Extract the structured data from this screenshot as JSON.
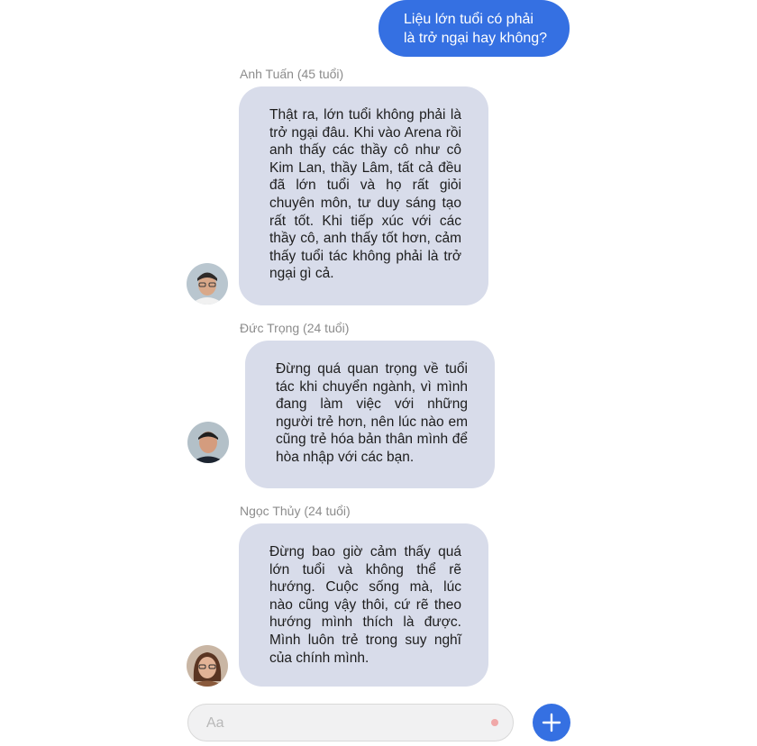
{
  "question": "Liệu lớn tuổi có phải là trở ngại hay không?",
  "messages": [
    {
      "sender": "Anh Tuấn (45 tuổi)",
      "text": "Thật ra, lớn tuổi không phải là trở ngại đâu. Khi vào Arena rồi anh thấy các thầy cô như cô Kim Lan, thầy Lâm, tất cả đều đã lớn tuổi và họ rất giỏi chuyên môn, tư duy sáng tạo rất tốt. Khi tiếp xúc với các thầy cô, anh thấy tốt hơn, cảm thấy tuổi tác không phải là trở ngại gì cả."
    },
    {
      "sender": "Đức Trọng (24 tuổi)",
      "text": "Đừng quá quan trọng về tuổi tác khi chuyển ngành, vì mình đang làm việc với những người trẻ hơn, nên lúc nào em cũng trẻ hóa bản thân mình để hòa nhập với các bạn."
    },
    {
      "sender": "Ngọc Thủy (24 tuổi)",
      "text": "Đừng bao giờ cảm thấy quá lớn tuổi và không thể rẽ hướng. Cuộc sống mà, lúc nào cũng vậy thôi, cứ rẽ theo hướng mình thích là được. Mình luôn trẻ trong suy nghĩ của chính mình."
    }
  ],
  "composer": {
    "placeholder": "Aa",
    "add_icon": "plus-icon"
  },
  "colors": {
    "accent": "#3570e2",
    "bubble_in": "#d8dcea",
    "dot": "#f0a8a8"
  }
}
